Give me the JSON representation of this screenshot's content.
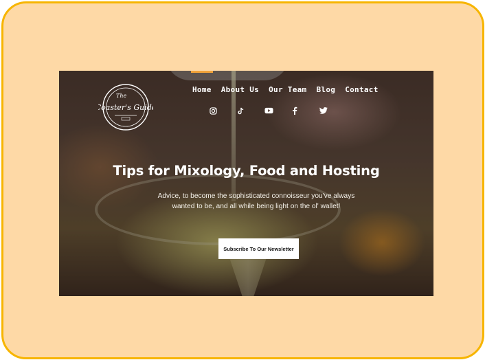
{
  "site": {
    "logo_text_top": "The",
    "logo_text_main": "Coaster's Guide",
    "brand_icon": "coaster-logo"
  },
  "nav": {
    "items": [
      {
        "label": "Home"
      },
      {
        "label": "About Us"
      },
      {
        "label": "Our Team"
      },
      {
        "label": "Blog"
      },
      {
        "label": "Contact"
      }
    ]
  },
  "social": [
    {
      "icon": "instagram-icon"
    },
    {
      "icon": "tiktok-icon"
    },
    {
      "icon": "youtube-icon"
    },
    {
      "icon": "facebook-icon"
    },
    {
      "icon": "twitter-icon"
    }
  ],
  "hero": {
    "headline": "Tips for Mixology, Food and Hosting",
    "tagline": "Advice, to become the sophisticated connoisseur you've always wanted to be, and all while being light on the ol' wallet!",
    "cta_label": "Subscribe To Our Newsletter"
  },
  "colors": {
    "frame_bg": "#fed9a6",
    "frame_border": "#f7b500",
    "accent": "#f2a33a"
  }
}
